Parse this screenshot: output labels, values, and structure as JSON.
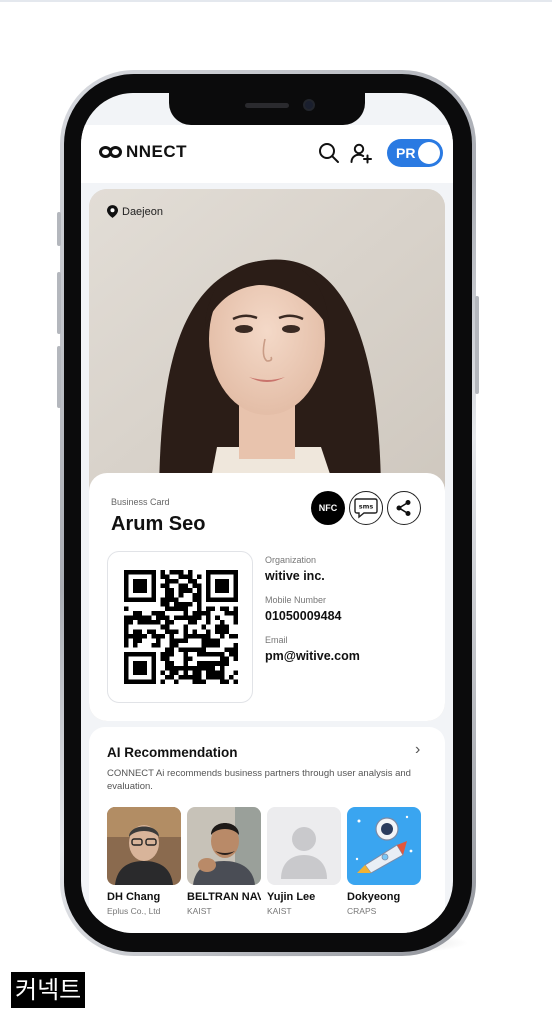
{
  "app": {
    "logo_text": "NNECT",
    "pr_toggle_label": "PR"
  },
  "card": {
    "location": "Daejeon",
    "label": "Business Card",
    "name": "Arum Seo",
    "nfc_label": "NFC",
    "sms_label": "sms",
    "fields": [
      {
        "label": "Organization",
        "value": "witive inc."
      },
      {
        "label": "Mobile Number",
        "value": "01050009484"
      },
      {
        "label": "Email",
        "value": "pm@witive.com"
      }
    ]
  },
  "ai": {
    "title": "AI Recommendation",
    "description": "CONNECT Ai recommends business partners through user analysis and evaluation.",
    "items": [
      {
        "name": "DH Chang",
        "org": "Eplus Co., Ltd"
      },
      {
        "name": "BELTRAN NAVA",
        "org": "KAIST"
      },
      {
        "name": "Yujin Lee",
        "org": "KAIST"
      },
      {
        "name": "Dokyeong",
        "org": "CRAPS"
      }
    ]
  },
  "caption": "커넥트",
  "colors": {
    "accent": "#2a7ae2",
    "rocket_bg": "#3aa5f0"
  }
}
